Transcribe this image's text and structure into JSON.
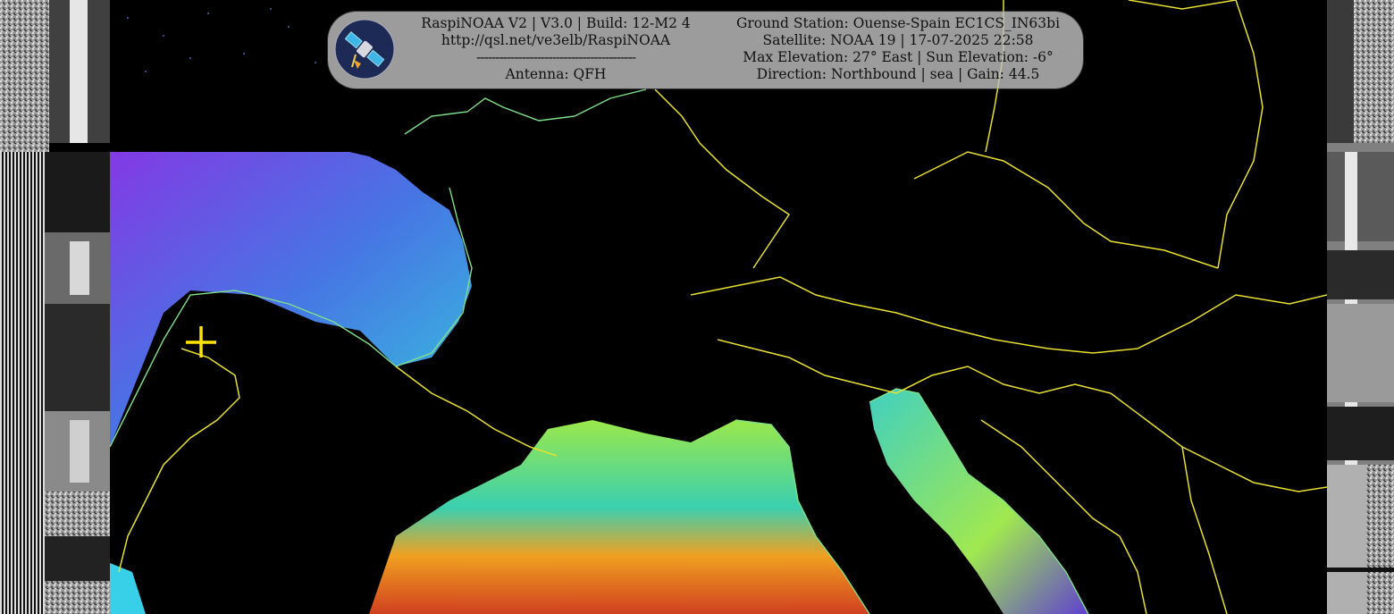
{
  "banner": {
    "left_lines": [
      "RaspiNOAA V2 | V3.0 | Build: 12-M2 4",
      "http://qsl.net/ve3elb/RaspiNOAA",
      "------------------------------------------",
      "Antenna: QFH"
    ],
    "right_lines": [
      "Ground Station: Ouense-Spain EC1CS_IN63bi",
      "Satellite: NOAA 19 | 17-07-2025 22:58",
      "Max Elevation: 27° East | Sun Elevation: -6°",
      "Direction: Northbound | sea | Gain: 44.5"
    ]
  },
  "colors": {
    "border_lines": "#e8e030",
    "coast_lines": "#7fe08a",
    "cloud_high": "#8a3cf0",
    "cloud_low": "#38d0e8",
    "sea_warm": "#f0a020",
    "sea_mid": "#9be84a",
    "marker": "#ffe400"
  },
  "icons": {
    "logo": "satellite-logo-icon",
    "marker": "crosshair-marker-icon"
  }
}
